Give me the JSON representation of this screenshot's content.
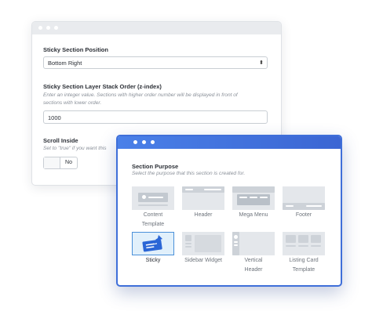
{
  "back_window": {
    "field1": {
      "label": "Sticky Section Position",
      "value": "Bottom Right"
    },
    "field2": {
      "label": "Sticky Section Layer Stack Order (z-index)",
      "description_line1": "Enter an integer value. Sections with higher order number will be displayed in front of",
      "description_line2": "sections with lower order.",
      "value": "1000"
    },
    "field3": {
      "label": "Scroll Inside",
      "description": "Set to \"true\" if you want this",
      "toggle_value": "No"
    }
  },
  "front_window": {
    "title": "Section Purpose",
    "description": "Select the purpose that this section is created for.",
    "cards": [
      {
        "line1": "Content",
        "line2": "Template",
        "icon": "content-template-icon",
        "selected": false
      },
      {
        "line1": "Header",
        "line2": "",
        "icon": "header-icon",
        "selected": false
      },
      {
        "line1": "Mega Menu",
        "line2": "",
        "icon": "mega-menu-icon",
        "selected": false
      },
      {
        "line1": "Footer",
        "line2": "",
        "icon": "footer-icon",
        "selected": false
      },
      {
        "line1": "Sticky",
        "line2": "",
        "icon": "sticky-pin-icon",
        "selected": true
      },
      {
        "line1": "Sidebar Widget",
        "line2": "",
        "icon": "sidebar-widget-icon",
        "selected": false
      },
      {
        "line1": "Vertical",
        "line2": "Header",
        "icon": "vertical-header-icon",
        "selected": false
      },
      {
        "line1": "Listing Card",
        "line2": "Template",
        "icon": "listing-card-icon",
        "selected": false
      }
    ]
  },
  "colors": {
    "accent": "#3f6fd9",
    "selected_card_bg": "#e1f0fb",
    "pin": "#2b66d6"
  }
}
